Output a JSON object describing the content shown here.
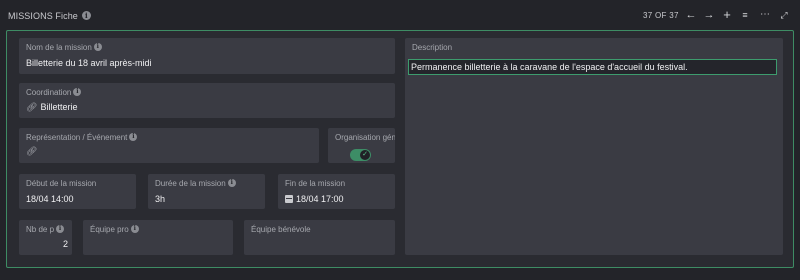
{
  "header": {
    "title": "MISSIONS Fiche",
    "pager": "37 OF 37"
  },
  "fields": {
    "nom": {
      "label": "Nom de la mission",
      "value": "Billetterie du 18 avril après-midi"
    },
    "coordination": {
      "label": "Coordination",
      "value": "Billetterie"
    },
    "representation": {
      "label": "Représentation / Événement",
      "value": ""
    },
    "organisation": {
      "label": "Organisation gén",
      "checked": true
    },
    "debut": {
      "label": "Début de la mission",
      "value": "18/04 14:00"
    },
    "duree": {
      "label": "Durée de la mission",
      "value": "3h"
    },
    "fin": {
      "label": "Fin de la mission",
      "value": "18/04 17:00"
    },
    "nb": {
      "label": "Nb de p",
      "value": "2"
    },
    "equipe_pro": {
      "label": "Équipe pro",
      "value": ""
    },
    "equipe_benevole": {
      "label": "Équipe bénévole",
      "value": ""
    },
    "description": {
      "label": "Description",
      "value": "Permanence billetterie à la caravane de l'espace d'accueil du festival."
    }
  },
  "icons": {
    "info": "info-circle-icon",
    "link": "link-icon",
    "calendar": "calendar-icon"
  },
  "colors": {
    "accent": "#3e8c64",
    "background": "#232429",
    "field": "#3a3b43"
  }
}
